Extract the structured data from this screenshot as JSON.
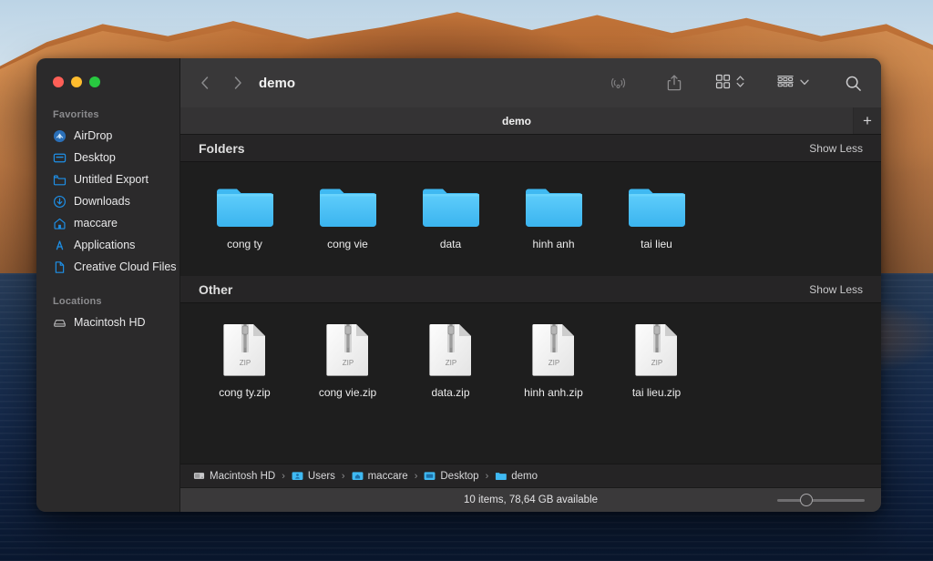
{
  "window": {
    "title": "demo",
    "traffic_lights": [
      {
        "name": "close",
        "color": "#ff5f57"
      },
      {
        "name": "minimize",
        "color": "#febc2e"
      },
      {
        "name": "zoom",
        "color": "#28c840"
      }
    ]
  },
  "toolbar": {
    "back_icon": "chevron-left-icon",
    "forward_icon": "chevron-right-icon",
    "title": "demo",
    "airdrop_icon": "airdrop-icon",
    "share_icon": "share-icon",
    "view_icon": "grid-view-icon",
    "view_chevron_icon": "chevron-updown-icon",
    "group_icon": "group-by-icon",
    "group_chevron_icon": "chevron-down-icon",
    "search_icon": "search-icon"
  },
  "tabbar": {
    "tabs": [
      {
        "label": "demo",
        "active": true
      }
    ],
    "add_label": "+"
  },
  "sidebar": {
    "groups": [
      {
        "title": "Favorites",
        "items": [
          {
            "label": "AirDrop",
            "icon": "airdrop-icon"
          },
          {
            "label": "Desktop",
            "icon": "desktop-icon"
          },
          {
            "label": "Untitled Export",
            "icon": "folder-icon"
          },
          {
            "label": "Downloads",
            "icon": "downloads-icon"
          },
          {
            "label": "maccare",
            "icon": "home-icon"
          },
          {
            "label": "Applications",
            "icon": "applications-icon"
          },
          {
            "label": "Creative Cloud Files",
            "icon": "document-icon"
          }
        ]
      },
      {
        "title": "Locations",
        "items": [
          {
            "label": "Macintosh HD",
            "icon": "harddisk-icon"
          }
        ]
      }
    ]
  },
  "content": {
    "sections": [
      {
        "title": "Folders",
        "link_label": "Show Less",
        "kind": "folder",
        "items": [
          {
            "label": "cong ty"
          },
          {
            "label": "cong vie"
          },
          {
            "label": "data"
          },
          {
            "label": "hinh anh"
          },
          {
            "label": "tai lieu"
          }
        ]
      },
      {
        "title": "Other",
        "link_label": "Show Less",
        "kind": "zip",
        "items": [
          {
            "label": "cong ty.zip",
            "badge": "ZIP"
          },
          {
            "label": "cong vie.zip",
            "badge": "ZIP"
          },
          {
            "label": "data.zip",
            "badge": "ZIP"
          },
          {
            "label": "hinh anh.zip",
            "badge": "ZIP"
          },
          {
            "label": "tai lieu.zip",
            "badge": "ZIP"
          }
        ]
      }
    ]
  },
  "pathbar": {
    "items": [
      {
        "label": "Macintosh HD",
        "icon": "harddisk-icon"
      },
      {
        "label": "Users",
        "icon": "users-folder-icon"
      },
      {
        "label": "maccare",
        "icon": "home-folder-icon"
      },
      {
        "label": "Desktop",
        "icon": "desktop-folder-icon"
      },
      {
        "label": "demo",
        "icon": "folder-icon"
      }
    ],
    "separator": "›"
  },
  "statusbar": {
    "text": "10 items, 78,64 GB available",
    "zoom_value": 30
  },
  "colors": {
    "folder_blue": "#4cc2f7",
    "accent_blue": "#1e90e8",
    "window_bg": "#1e1e1e",
    "sidebar_bg": "#2b2a2b",
    "toolbar_bg": "#393839"
  }
}
